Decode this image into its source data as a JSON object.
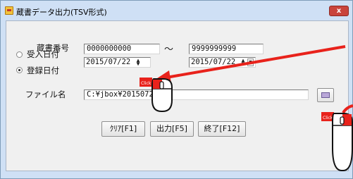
{
  "window": {
    "title": "蔵書データ出力(TSV形式)",
    "close_label": "x"
  },
  "book_number": {
    "label": "蔵書番号",
    "from_value": "0000000000",
    "separator": "～",
    "to_value": "9999999999"
  },
  "date_mode": {
    "options": [
      {
        "label": "受入日付",
        "selected": false
      },
      {
        "label": "登録日付",
        "selected": true
      }
    ]
  },
  "dates": {
    "from_value": "2015/07/22",
    "to_value": "2015/07/22"
  },
  "file": {
    "label": "ファイル名",
    "value": "C:¥jbox¥2015072"
  },
  "buttons": {
    "clear": "ｸﾘｱ[F1]",
    "output": "出力[F5]",
    "exit": "終了[F12]"
  },
  "annotation": {
    "click_text": "Click",
    "arrow_color": "#e8221b"
  }
}
